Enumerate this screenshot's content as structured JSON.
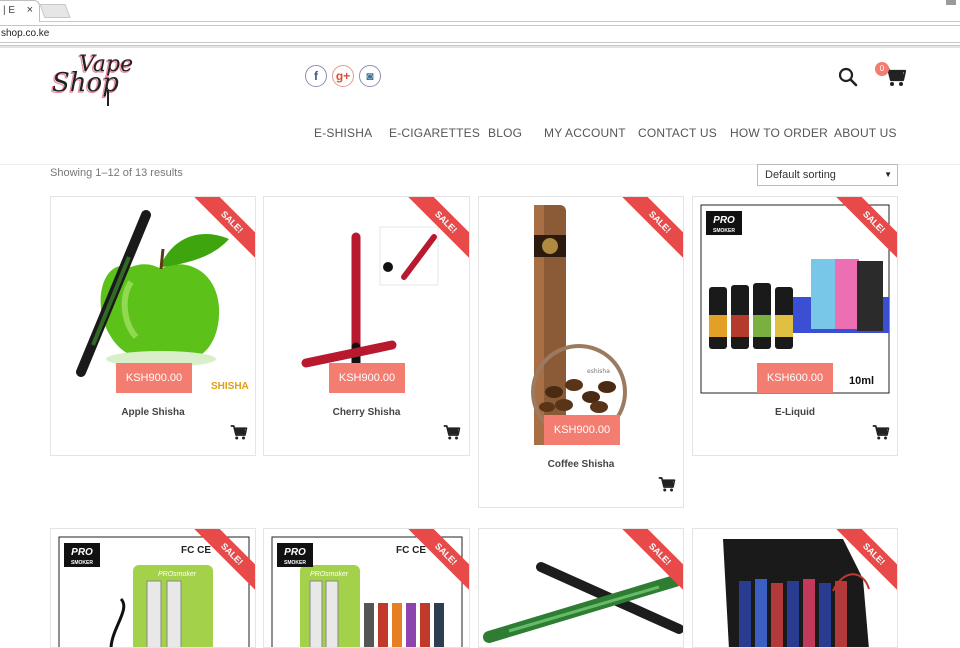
{
  "browser": {
    "tab_title": "| E",
    "tab_close": "×",
    "address": "shop.co.ke"
  },
  "site": {
    "logo": "Vape Shop",
    "social_icons": [
      "facebook-icon",
      "google-plus-icon",
      "instagram-icon"
    ],
    "social_glyphs": [
      "f",
      "g+",
      "◙"
    ],
    "cart_count": "0",
    "nav": [
      "E-SHISHA",
      "E-CIGARETTES",
      "BLOG",
      "MY ACCOUNT",
      "CONTACT US",
      "HOW TO ORDER",
      "ABOUT US"
    ],
    "results_text": "Showing 1–12 of 13 results",
    "sorting_value": "Default sorting",
    "sorting_caret": "▼",
    "accent_color": "#f27d70",
    "sale_color": "#e84a4a"
  },
  "products": [
    {
      "name": "Apple Shisha",
      "price": "KSH900.00",
      "sale": "SALE!",
      "image_text": "SHISHA"
    },
    {
      "name": "Cherry Shisha",
      "price": "KSH900.00",
      "sale": "SALE!"
    },
    {
      "name": "Coffee Shisha",
      "price": "KSH900.00",
      "sale": "SALE!",
      "image_text": "eshisha"
    },
    {
      "name": "E-Liquid",
      "price": "KSH600.00",
      "sale": "SALE!",
      "image_text": "10ml",
      "badge": "PRO"
    },
    {
      "name": "",
      "sale": "SALE!",
      "badge": "PRO",
      "image_text": "FC CE",
      "box_text": "PROsmoker"
    },
    {
      "name": "",
      "sale": "SALE!",
      "badge": "PRO",
      "image_text": "FC CE",
      "box_text": "PROsmoker"
    },
    {
      "name": "",
      "sale": "SALE!"
    },
    {
      "name": "",
      "sale": "SALE!"
    }
  ],
  "badge_subtext": "SMOKER"
}
